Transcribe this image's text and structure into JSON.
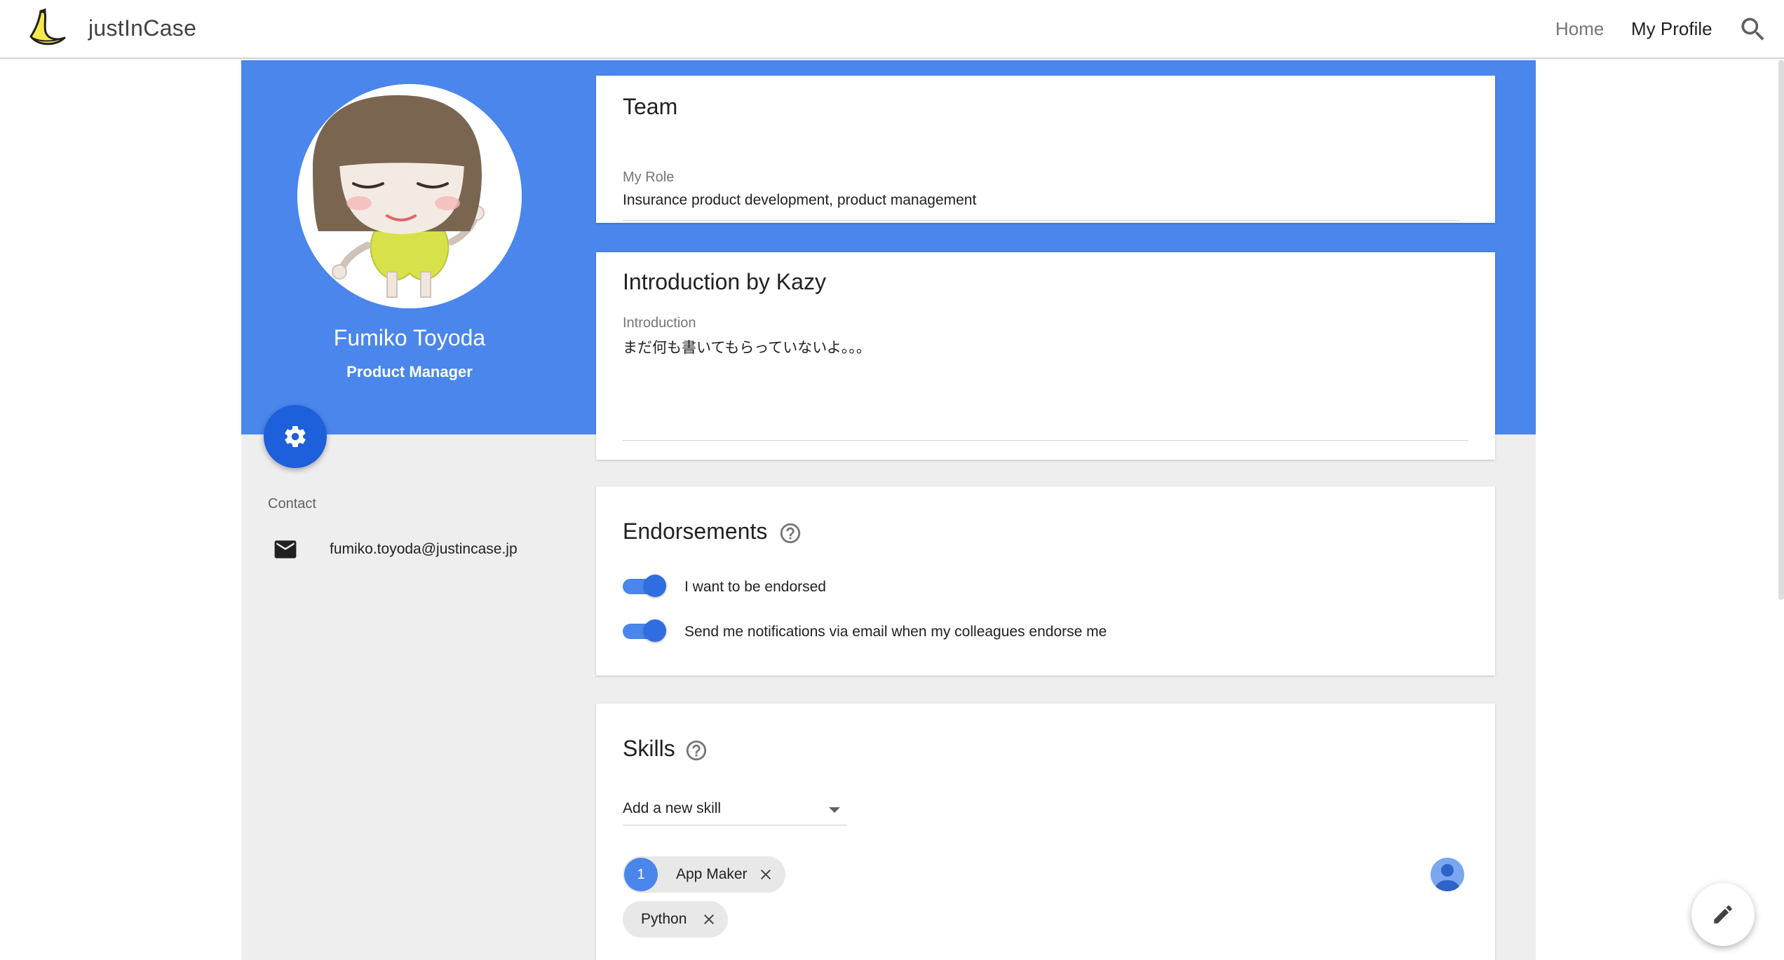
{
  "app": {
    "brand": "justInCase"
  },
  "nav": {
    "home": "Home",
    "my_profile": "My Profile"
  },
  "profile": {
    "name": "Fumiko Toyoda",
    "title": "Product Manager",
    "contact_label": "Contact",
    "email": "fumiko.toyoda@justincase.jp"
  },
  "team": {
    "title": "Team",
    "role_label": "My Role",
    "role_value": "Insurance product development, product management"
  },
  "introduction": {
    "title": "Introduction by Kazy",
    "label": "Introduction",
    "value": "まだ何も書いてもらっていないよ。。。"
  },
  "endorsements": {
    "title": "Endorsements",
    "toggles": [
      {
        "label": "I want to be endorsed",
        "on": true
      },
      {
        "label": "Send me notifications via email when my colleagues endorse me",
        "on": true
      }
    ]
  },
  "skills": {
    "title": "Skills",
    "select_value": "Add a new skill",
    "chips": [
      {
        "count": "1",
        "label": "App Maker"
      },
      {
        "count": "",
        "label": "Python"
      }
    ]
  },
  "colors": {
    "primary": "#4a86ec",
    "primary_dark": "#1e5fdb",
    "background": "#eeeeee"
  },
  "icons": {
    "logo": "banana-logo-icon",
    "search": "search-icon",
    "settings": "gear-icon",
    "mail": "mail-icon",
    "help": "help-circle-icon",
    "close": "close-icon",
    "edit": "pencil-icon",
    "person": "person-icon"
  }
}
